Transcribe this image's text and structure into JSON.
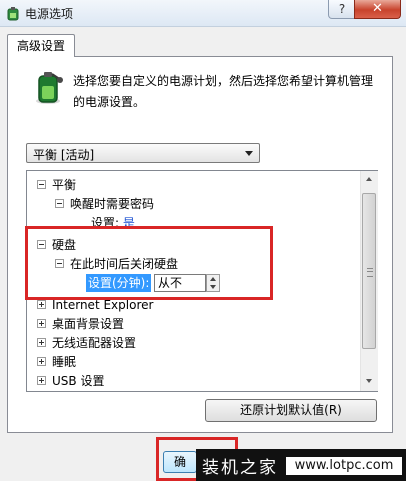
{
  "window": {
    "title": "电源选项",
    "help_label": "?",
    "close_label": "✕"
  },
  "tab": {
    "label": "高级设置"
  },
  "description": "选择您要自定义的电源计划，然后选择您希望计算机管理的电源设置。",
  "plan_select": {
    "value": "平衡 [活动]"
  },
  "tree": {
    "rows": [
      {
        "label": "平衡"
      },
      {
        "label": "唤醒时需要密码"
      },
      {
        "label": "设置:",
        "value": "是"
      },
      {
        "label": "硬盘"
      },
      {
        "label": "在此时间后关闭硬盘"
      },
      {
        "label": "设置(分钟):",
        "value": "从不"
      },
      {
        "label": "Internet Explorer"
      },
      {
        "label": "桌面背景设置"
      },
      {
        "label": "无线适配器设置"
      },
      {
        "label": "睡眠"
      },
      {
        "label": "USB 设置"
      }
    ]
  },
  "restore_button": "还原计划默认值(R)",
  "ok_button": "确",
  "watermark": {
    "text": "装机之家",
    "url": "www.lotpc.com"
  },
  "colors": {
    "highlight": "#3399ff",
    "annotation": "#d92626",
    "link": "#1a4fd1"
  }
}
